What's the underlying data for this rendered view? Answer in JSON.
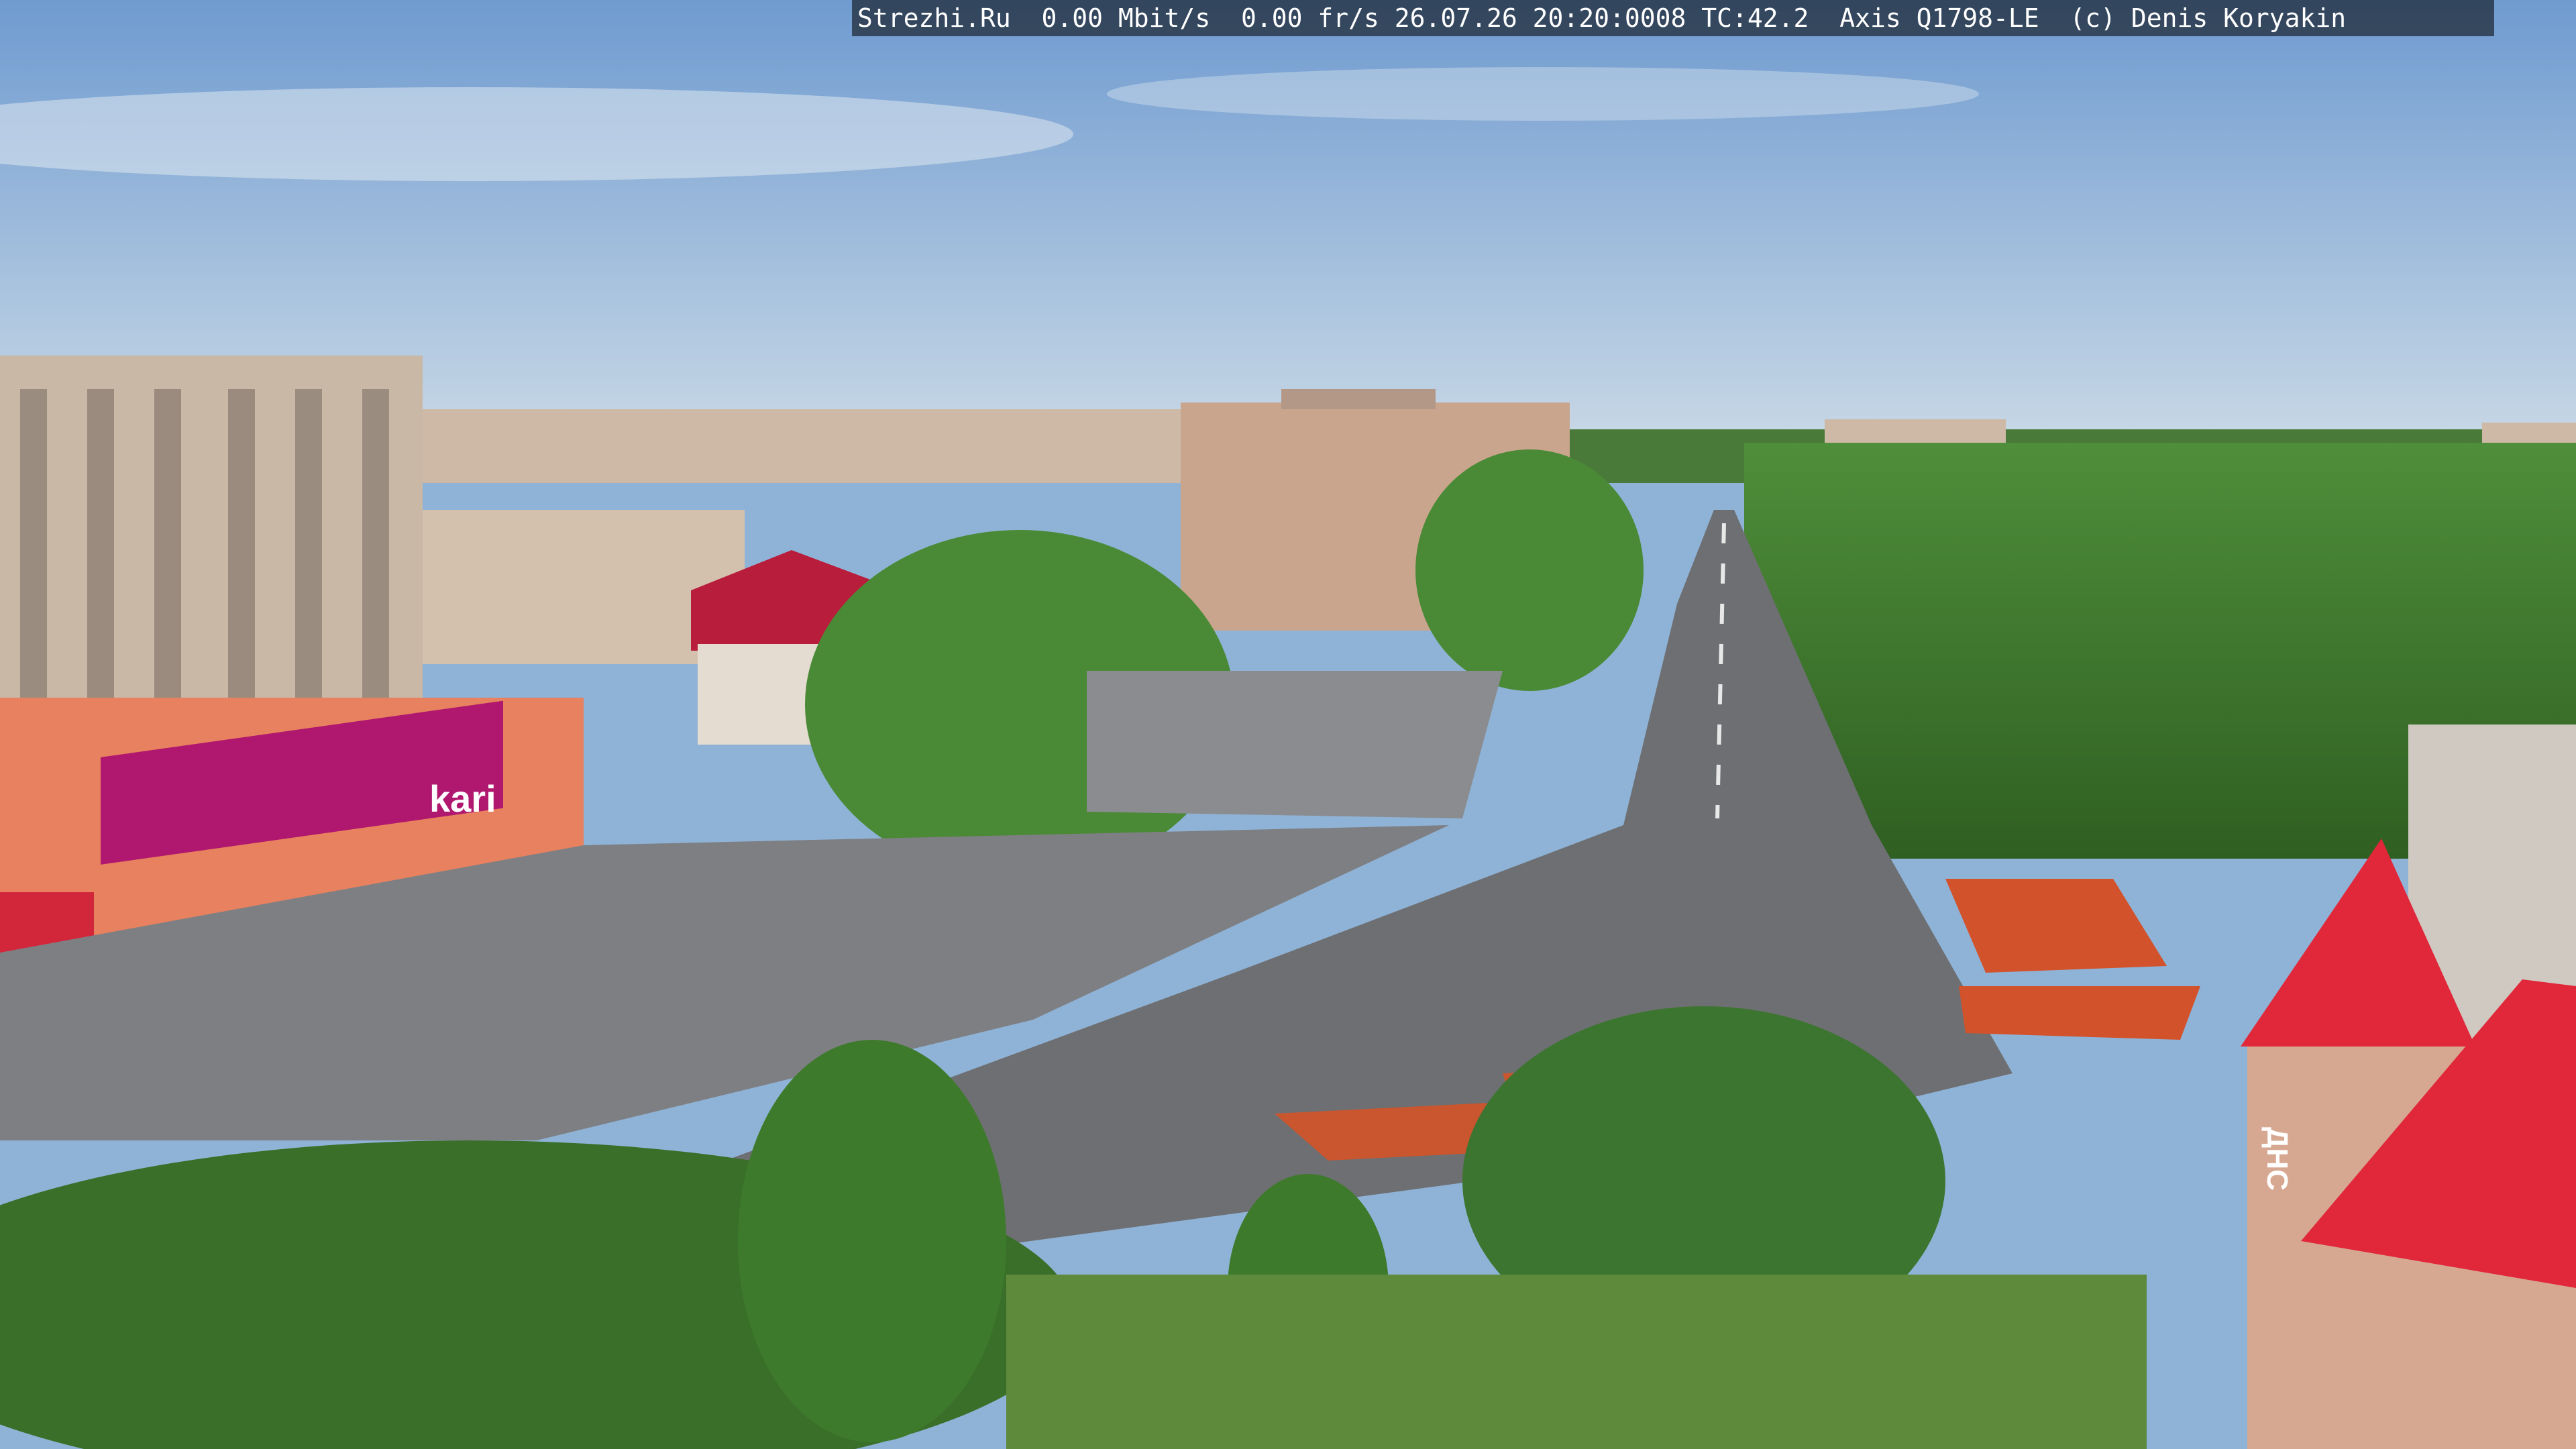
{
  "overlay": {
    "text": "Strezhi.Ru  0.00 Mbit/s  0.00 fr/s 26.07.26 20:20:0008 TC:42.2  Axis Q1798-LE  (c) Denis Koryakin"
  },
  "signs": {
    "store_logo": "kari",
    "pharmacy": "ДНС"
  },
  "colors": {
    "sky_top": "#6f9bd0",
    "sky_bottom": "#c8d8e6",
    "trees": "#3d7a2e",
    "asphalt": "#6e6f72",
    "plaza": "#8a8c90",
    "roof_red": "#d8283a",
    "kari_magenta": "#b0186f",
    "building_beige": "#cbb49f",
    "flowers": "#d2522b"
  }
}
